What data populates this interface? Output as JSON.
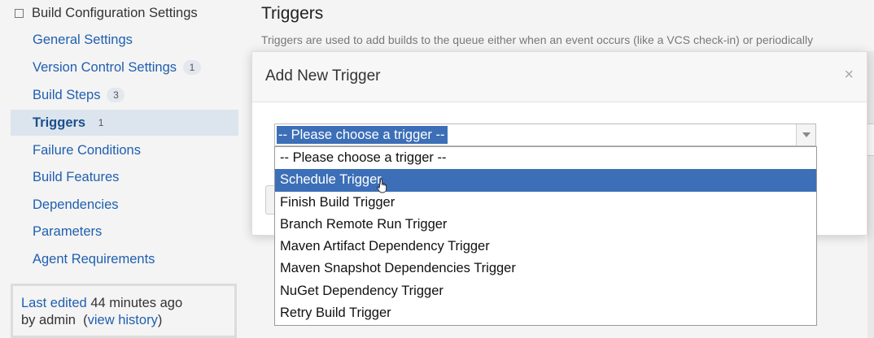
{
  "sidebar": {
    "header": "Build Configuration Settings",
    "items": [
      {
        "label": "General Settings",
        "count": ""
      },
      {
        "label": "Version Control Settings",
        "count": "1"
      },
      {
        "label": "Build Steps",
        "count": "3"
      },
      {
        "label": "Triggers",
        "count": "1",
        "active": true
      },
      {
        "label": "Failure Conditions",
        "count": ""
      },
      {
        "label": "Build Features",
        "count": ""
      },
      {
        "label": "Dependencies",
        "count": ""
      },
      {
        "label": "Parameters",
        "count": ""
      },
      {
        "label": "Agent Requirements",
        "count": ""
      }
    ],
    "last_edited": {
      "prefix": "Last edited",
      "time": "44 minutes ago",
      "by": "by admin",
      "history_link": "view history"
    }
  },
  "main": {
    "title": "Triggers",
    "description": "Triggers are used to add builds to the queue either when an event occurs (like a VCS check-in) or periodically"
  },
  "modal": {
    "title": "Add New Trigger",
    "close_icon": "×",
    "select": {
      "value": "-- Please choose a trigger --",
      "options": [
        "-- Please choose a trigger --",
        "Schedule Trigger",
        "Finish Build Trigger",
        "Branch Remote Run Trigger",
        "Maven Artifact Dependency Trigger",
        "Maven Snapshot Dependencies Trigger",
        "NuGet Dependency Trigger",
        "Retry Build Trigger"
      ],
      "highlighted": "Schedule Trigger"
    }
  },
  "colors": {
    "accent": "#3c6fb7",
    "link": "#1f5fb0",
    "active_bg": "#dce5ee"
  }
}
